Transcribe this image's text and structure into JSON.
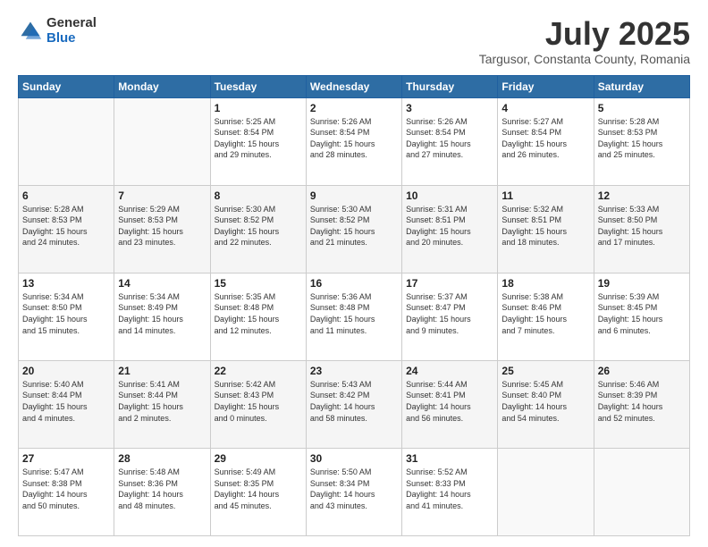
{
  "logo": {
    "general": "General",
    "blue": "Blue"
  },
  "title": "July 2025",
  "subtitle": "Targusor, Constanta County, Romania",
  "days_of_week": [
    "Sunday",
    "Monday",
    "Tuesday",
    "Wednesday",
    "Thursday",
    "Friday",
    "Saturday"
  ],
  "weeks": [
    [
      {
        "day": "",
        "info": ""
      },
      {
        "day": "",
        "info": ""
      },
      {
        "day": "1",
        "info": "Sunrise: 5:25 AM\nSunset: 8:54 PM\nDaylight: 15 hours\nand 29 minutes."
      },
      {
        "day": "2",
        "info": "Sunrise: 5:26 AM\nSunset: 8:54 PM\nDaylight: 15 hours\nand 28 minutes."
      },
      {
        "day": "3",
        "info": "Sunrise: 5:26 AM\nSunset: 8:54 PM\nDaylight: 15 hours\nand 27 minutes."
      },
      {
        "day": "4",
        "info": "Sunrise: 5:27 AM\nSunset: 8:54 PM\nDaylight: 15 hours\nand 26 minutes."
      },
      {
        "day": "5",
        "info": "Sunrise: 5:28 AM\nSunset: 8:53 PM\nDaylight: 15 hours\nand 25 minutes."
      }
    ],
    [
      {
        "day": "6",
        "info": "Sunrise: 5:28 AM\nSunset: 8:53 PM\nDaylight: 15 hours\nand 24 minutes."
      },
      {
        "day": "7",
        "info": "Sunrise: 5:29 AM\nSunset: 8:53 PM\nDaylight: 15 hours\nand 23 minutes."
      },
      {
        "day": "8",
        "info": "Sunrise: 5:30 AM\nSunset: 8:52 PM\nDaylight: 15 hours\nand 22 minutes."
      },
      {
        "day": "9",
        "info": "Sunrise: 5:30 AM\nSunset: 8:52 PM\nDaylight: 15 hours\nand 21 minutes."
      },
      {
        "day": "10",
        "info": "Sunrise: 5:31 AM\nSunset: 8:51 PM\nDaylight: 15 hours\nand 20 minutes."
      },
      {
        "day": "11",
        "info": "Sunrise: 5:32 AM\nSunset: 8:51 PM\nDaylight: 15 hours\nand 18 minutes."
      },
      {
        "day": "12",
        "info": "Sunrise: 5:33 AM\nSunset: 8:50 PM\nDaylight: 15 hours\nand 17 minutes."
      }
    ],
    [
      {
        "day": "13",
        "info": "Sunrise: 5:34 AM\nSunset: 8:50 PM\nDaylight: 15 hours\nand 15 minutes."
      },
      {
        "day": "14",
        "info": "Sunrise: 5:34 AM\nSunset: 8:49 PM\nDaylight: 15 hours\nand 14 minutes."
      },
      {
        "day": "15",
        "info": "Sunrise: 5:35 AM\nSunset: 8:48 PM\nDaylight: 15 hours\nand 12 minutes."
      },
      {
        "day": "16",
        "info": "Sunrise: 5:36 AM\nSunset: 8:48 PM\nDaylight: 15 hours\nand 11 minutes."
      },
      {
        "day": "17",
        "info": "Sunrise: 5:37 AM\nSunset: 8:47 PM\nDaylight: 15 hours\nand 9 minutes."
      },
      {
        "day": "18",
        "info": "Sunrise: 5:38 AM\nSunset: 8:46 PM\nDaylight: 15 hours\nand 7 minutes."
      },
      {
        "day": "19",
        "info": "Sunrise: 5:39 AM\nSunset: 8:45 PM\nDaylight: 15 hours\nand 6 minutes."
      }
    ],
    [
      {
        "day": "20",
        "info": "Sunrise: 5:40 AM\nSunset: 8:44 PM\nDaylight: 15 hours\nand 4 minutes."
      },
      {
        "day": "21",
        "info": "Sunrise: 5:41 AM\nSunset: 8:44 PM\nDaylight: 15 hours\nand 2 minutes."
      },
      {
        "day": "22",
        "info": "Sunrise: 5:42 AM\nSunset: 8:43 PM\nDaylight: 15 hours\nand 0 minutes."
      },
      {
        "day": "23",
        "info": "Sunrise: 5:43 AM\nSunset: 8:42 PM\nDaylight: 14 hours\nand 58 minutes."
      },
      {
        "day": "24",
        "info": "Sunrise: 5:44 AM\nSunset: 8:41 PM\nDaylight: 14 hours\nand 56 minutes."
      },
      {
        "day": "25",
        "info": "Sunrise: 5:45 AM\nSunset: 8:40 PM\nDaylight: 14 hours\nand 54 minutes."
      },
      {
        "day": "26",
        "info": "Sunrise: 5:46 AM\nSunset: 8:39 PM\nDaylight: 14 hours\nand 52 minutes."
      }
    ],
    [
      {
        "day": "27",
        "info": "Sunrise: 5:47 AM\nSunset: 8:38 PM\nDaylight: 14 hours\nand 50 minutes."
      },
      {
        "day": "28",
        "info": "Sunrise: 5:48 AM\nSunset: 8:36 PM\nDaylight: 14 hours\nand 48 minutes."
      },
      {
        "day": "29",
        "info": "Sunrise: 5:49 AM\nSunset: 8:35 PM\nDaylight: 14 hours\nand 45 minutes."
      },
      {
        "day": "30",
        "info": "Sunrise: 5:50 AM\nSunset: 8:34 PM\nDaylight: 14 hours\nand 43 minutes."
      },
      {
        "day": "31",
        "info": "Sunrise: 5:52 AM\nSunset: 8:33 PM\nDaylight: 14 hours\nand 41 minutes."
      },
      {
        "day": "",
        "info": ""
      },
      {
        "day": "",
        "info": ""
      }
    ]
  ]
}
